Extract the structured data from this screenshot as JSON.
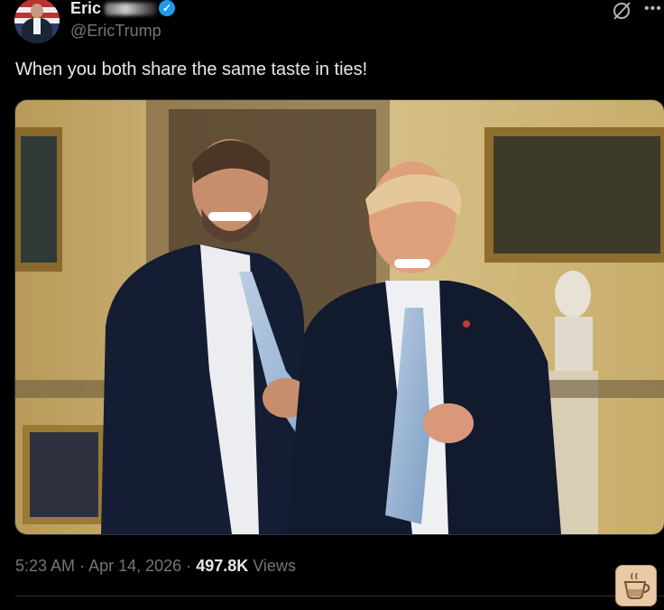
{
  "tweet": {
    "display_name": "Eric",
    "handle": "@EricTrump",
    "verified_mark": "✓",
    "text": "When you both share the same taste in ties!",
    "time": "5:23 AM",
    "date": "Apr 14, 2026",
    "views_count": "497.8K",
    "views_label": "Views",
    "separator": "·"
  },
  "icons": {
    "grok": "grok-icon",
    "more": "more-icon",
    "coffee": "coffee-cup-icon"
  },
  "colors": {
    "background": "#000000",
    "text": "#e7e9ea",
    "secondary": "#71767b",
    "verified": "#1d9bf0",
    "border": "#2f3336"
  }
}
